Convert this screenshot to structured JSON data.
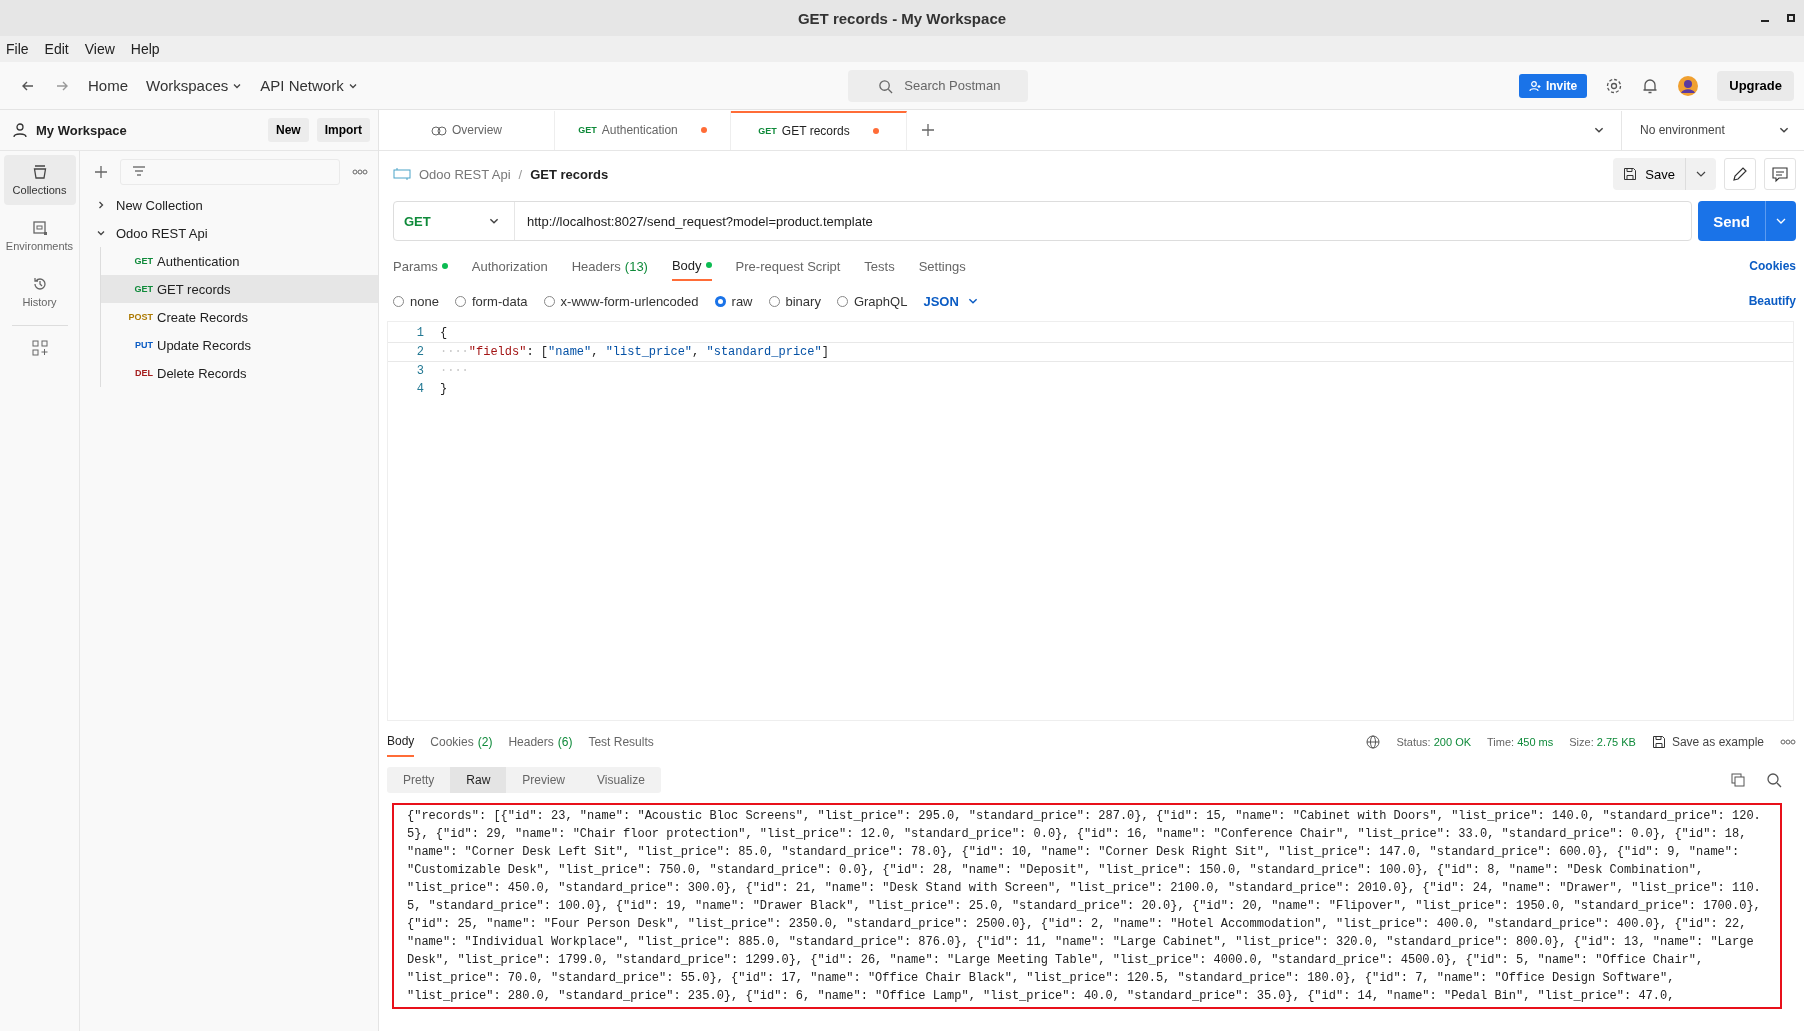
{
  "window": {
    "title": "GET records - My Workspace"
  },
  "menu": [
    "File",
    "Edit",
    "View",
    "Help"
  ],
  "header": {
    "nav": [
      {
        "label": "Home",
        "kind": "link"
      },
      {
        "label": "Workspaces",
        "kind": "dropdown"
      },
      {
        "label": "API Network",
        "kind": "dropdown"
      }
    ],
    "search": {
      "placeholder": "Search Postman"
    },
    "invite": "Invite",
    "upgrade": "Upgrade"
  },
  "sidebar": {
    "workspace": "My Workspace",
    "buttons": [
      "New",
      "Import"
    ],
    "rail": [
      {
        "label": "Collections",
        "kind": "collections",
        "selected": true
      },
      {
        "label": "Environments",
        "kind": "environments",
        "selected": false
      },
      {
        "label": "History",
        "kind": "history",
        "selected": false
      }
    ],
    "tree": [
      {
        "name": "New Collection",
        "expanded": false
      },
      {
        "name": "Odoo REST Api",
        "expanded": true,
        "children": [
          {
            "method": "GET",
            "color": "#0f8a3a",
            "name": "Authentication",
            "selected": false
          },
          {
            "method": "GET",
            "color": "#0f8a3a",
            "name": "GET records",
            "selected": true
          },
          {
            "method": "POST",
            "color": "#ad7a03",
            "name": "Create Records",
            "selected": false
          },
          {
            "method": "PUT",
            "color": "#0b5cc4",
            "name": "Update Records",
            "selected": false
          },
          {
            "method": "DEL",
            "color": "#a51e1e",
            "name": "Delete Records",
            "selected": false
          }
        ]
      }
    ]
  },
  "tabs": [
    {
      "kind": "overview",
      "label": "Overview",
      "selected": false,
      "unsaved": false
    },
    {
      "kind": "request",
      "method": "GET",
      "label": "Authentication",
      "selected": false,
      "unsaved": true
    },
    {
      "kind": "request",
      "method": "GET",
      "label": "GET records",
      "selected": true,
      "unsaved": true
    }
  ],
  "environment": "No environment",
  "request": {
    "breadcrumb": [
      "Odoo REST Api",
      "GET records"
    ],
    "separator": "/",
    "save": "Save",
    "method": "GET",
    "url": "http://localhost:8027/send_request?model=product.template",
    "send": "Send",
    "tabs": [
      {
        "label": "Params",
        "dot": true,
        "selected": false
      },
      {
        "label": "Authorization",
        "dot": false,
        "selected": false
      },
      {
        "label": "Headers",
        "count": "(13)",
        "dot": false,
        "selected": false
      },
      {
        "label": "Body",
        "dot": true,
        "selected": true
      },
      {
        "label": "Pre-request Script",
        "dot": false,
        "selected": false
      },
      {
        "label": "Tests",
        "dot": false,
        "selected": false
      },
      {
        "label": "Settings",
        "dot": false,
        "selected": false
      }
    ],
    "cookies": "Cookies",
    "body_modes": [
      {
        "label": "none",
        "selected": false
      },
      {
        "label": "form-data",
        "selected": false
      },
      {
        "label": "x-www-form-urlencoded",
        "selected": false
      },
      {
        "label": "raw",
        "selected": true
      },
      {
        "label": "binary",
        "selected": false
      },
      {
        "label": "GraphQL",
        "selected": false
      }
    ],
    "format": "JSON",
    "beautify": "Beautify",
    "editor": [
      {
        "number": "1",
        "tokens": [
          {
            "kind": "punct",
            "text": "{"
          }
        ]
      },
      {
        "number": "2",
        "tokens": [
          {
            "kind": "ws",
            "text": "····"
          },
          {
            "kind": "key",
            "text": "\"fields\""
          },
          {
            "kind": "punct",
            "text": ": ["
          },
          {
            "kind": "string",
            "text": "\"name\""
          },
          {
            "kind": "punct",
            "text": ", "
          },
          {
            "kind": "string",
            "text": "\"list_price\""
          },
          {
            "kind": "punct",
            "text": ", "
          },
          {
            "kind": "string",
            "text": "\"standard_price\""
          },
          {
            "kind": "punct",
            "text": "]"
          }
        ]
      },
      {
        "number": "3",
        "tokens": [
          {
            "kind": "ws",
            "text": "····"
          }
        ]
      },
      {
        "number": "4",
        "tokens": [
          {
            "kind": "punct",
            "text": "}"
          }
        ]
      }
    ]
  },
  "response": {
    "tabs": [
      {
        "label": "Body",
        "selected": true
      },
      {
        "label": "Cookies",
        "count": "(2)",
        "selected": false
      },
      {
        "label": "Headers",
        "count": "(6)",
        "selected": false
      },
      {
        "label": "Test Results",
        "selected": false
      }
    ],
    "stats": [
      {
        "label": "Status:",
        "value": "200 OK"
      },
      {
        "label": "Time:",
        "value": "450 ms"
      },
      {
        "label": "Size:",
        "value": "2.75 KB"
      }
    ],
    "save_example": "Save as example",
    "views": [
      {
        "label": "Pretty",
        "selected": false
      },
      {
        "label": "Raw",
        "selected": true
      },
      {
        "label": "Preview",
        "selected": false
      },
      {
        "label": "Visualize",
        "selected": false
      }
    ],
    "raw_lines": [
      "{\"records\": [{\"id\": 23, \"name\": \"Acoustic Bloc Screens\", \"list_price\": 295.0, \"standard_price\": 287.0}, {\"id\": 15, \"name\": \"Cabinet with Doors\", \"list_price\": 140.0, \"standard_price\": 120.",
      "5}, {\"id\": 29, \"name\": \"Chair floor protection\", \"list_price\": 12.0, \"standard_price\": 0.0}, {\"id\": 16, \"name\": \"Conference Chair\", \"list_price\": 33.0, \"standard_price\": 0.0}, {\"id\": 18,",
      "\"name\": \"Corner Desk Left Sit\", \"list_price\": 85.0, \"standard_price\": 78.0}, {\"id\": 10, \"name\": \"Corner Desk Right Sit\", \"list_price\": 147.0, \"standard_price\": 600.0}, {\"id\": 9, \"name\":",
      "\"Customizable Desk\", \"list_price\": 750.0, \"standard_price\": 0.0}, {\"id\": 28, \"name\": \"Deposit\", \"list_price\": 150.0, \"standard_price\": 100.0}, {\"id\": 8, \"name\": \"Desk Combination\",",
      "\"list_price\": 450.0, \"standard_price\": 300.0}, {\"id\": 21, \"name\": \"Desk Stand with Screen\", \"list_price\": 2100.0, \"standard_price\": 2010.0}, {\"id\": 24, \"name\": \"Drawer\", \"list_price\": 110.",
      "5, \"standard_price\": 100.0}, {\"id\": 19, \"name\": \"Drawer Black\", \"list_price\": 25.0, \"standard_price\": 20.0}, {\"id\": 20, \"name\": \"Flipover\", \"list_price\": 1950.0, \"standard_price\": 1700.0},",
      "{\"id\": 25, \"name\": \"Four Person Desk\", \"list_price\": 2350.0, \"standard_price\": 2500.0}, {\"id\": 2, \"name\": \"Hotel Accommodation\", \"list_price\": 400.0, \"standard_price\": 400.0}, {\"id\": 22,",
      "\"name\": \"Individual Workplace\", \"list_price\": 885.0, \"standard_price\": 876.0}, {\"id\": 11, \"name\": \"Large Cabinet\", \"list_price\": 320.0, \"standard_price\": 800.0}, {\"id\": 13, \"name\": \"Large",
      "Desk\", \"list_price\": 1799.0, \"standard_price\": 1299.0}, {\"id\": 26, \"name\": \"Large Meeting Table\", \"list_price\": 4000.0, \"standard_price\": 4500.0}, {\"id\": 5, \"name\": \"Office Chair\",",
      "\"list_price\": 70.0, \"standard_price\": 55.0}, {\"id\": 17, \"name\": \"Office Chair Black\", \"list_price\": 120.5, \"standard_price\": 180.0}, {\"id\": 7, \"name\": \"Office Design Software\",",
      "\"list_price\": 280.0, \"standard_price\": 235.0}, {\"id\": 6, \"name\": \"Office Lamp\", \"list_price\": 40.0, \"standard_price\": 35.0}, {\"id\": 14, \"name\": \"Pedal Bin\", \"list_price\": 47.0,"
    ]
  }
}
